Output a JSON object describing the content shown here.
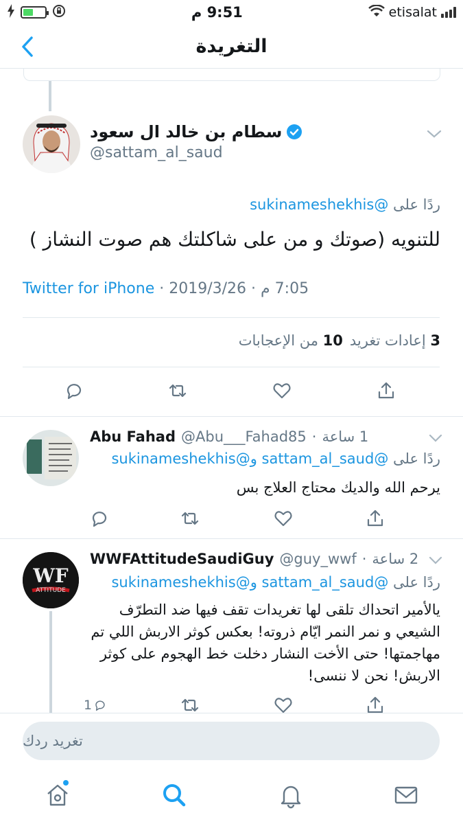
{
  "status_bar": {
    "time": "9:51 م",
    "carrier": "etisalat"
  },
  "nav": {
    "title": "التغريدة"
  },
  "main_tweet": {
    "author_name": "سطام بن خالد ال سعود",
    "author_handle": "@sattam_al_saud",
    "reply_prefix": "ردًا على",
    "reply_to": "@sukinameshekhis",
    "text": "للتنويه (صوتك و من على شاكلتك هم صوت النشاز )",
    "source": "Twitter for iPhone",
    "date": "2019/3/26",
    "time": "7:05 م",
    "likes_count": "10",
    "likes_label": "من الإعجابات",
    "retweets_count": "3",
    "retweets_label": "إعادات تغريد"
  },
  "replies": [
    {
      "name": "Abu Fahad",
      "handle": "@Abu___Fahad85",
      "time": "1 ساعة",
      "reply_prefix": "ردًا على",
      "reply_to_1": "@sattam_al_saud",
      "and": "و",
      "reply_to_2": "@sukinameshekhis",
      "text": "يرحم الله والديك محتاج العلاج بس",
      "reply_count": ""
    },
    {
      "name": "WWFAttitudeSaudiGuy",
      "handle": "@guy_wwf",
      "time": "2 ساعة",
      "reply_prefix": "ردًا على",
      "reply_to_1": "@sattam_al_saud",
      "and": "و",
      "reply_to_2": "@sukinameshekhis",
      "text": "يالأمير اتحداك تلقى لها تغريدات تقف فيها ضد التطرّف الشيعي و نمر النمر ايّام ذروته! بعكس كوثر الاربش اللي تم مهاجمتها! حتى الأخت النشار دخلت خط الهجوم على كوثر الاربش! نحن لا ننسى!",
      "reply_count": "1"
    }
  ],
  "compose": {
    "placeholder": "تغريد ردك"
  },
  "colors": {
    "link": "#1b95e0",
    "verified": "#1da1f2",
    "muted": "#657786"
  }
}
